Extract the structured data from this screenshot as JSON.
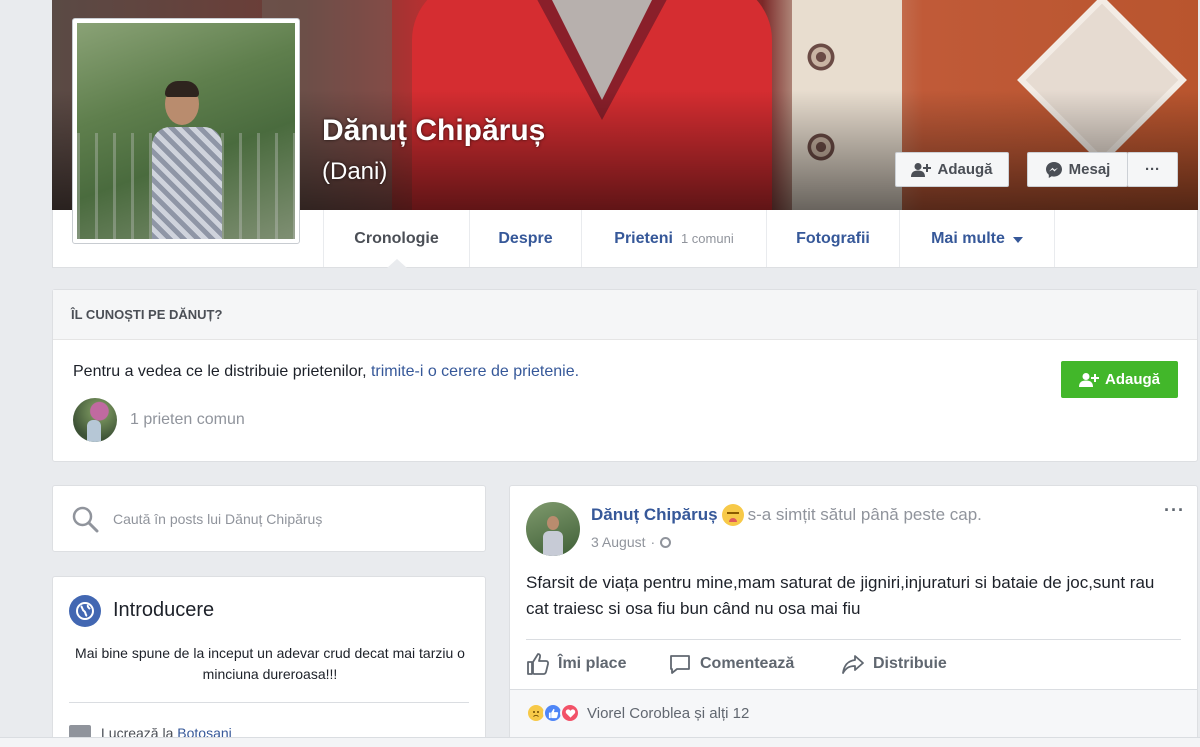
{
  "profile": {
    "name": "Dănuț Chipăruș",
    "nickname": "(Dani)"
  },
  "cover_buttons": {
    "add_label": "Adaugă",
    "message_label": "Mesaj",
    "more_label": "···"
  },
  "nav": {
    "tabs": [
      {
        "label": "Cronologie"
      },
      {
        "label": "Despre"
      },
      {
        "label": "Prieteni",
        "sub": "1 comuni"
      },
      {
        "label": "Fotografii"
      },
      {
        "label": "Mai multe"
      }
    ]
  },
  "know_card": {
    "heading": "ÎL CUNOȘTI PE DĂNUȚ?",
    "text": "Pentru a vedea ce le distribuie prietenilor, ",
    "link": "trimite-i o cerere de prietenie.",
    "add_label": "Adaugă",
    "mutual": "1 prieten comun"
  },
  "search": {
    "placeholder": "Caută în posts lui Dănuț Chipăruș"
  },
  "intro": {
    "title": "Introducere",
    "bio": "Mai bine spune de la inceput un adevar crud decat mai tarziu o minciuna dureroasa!!!",
    "work_prefix": "Lucrează la ",
    "work_place": "Botosani"
  },
  "post": {
    "author": "Dănuț Chipăruș",
    "feeling": "s-a simțit sătul până peste cap.",
    "date": "3 August",
    "dots": "···",
    "body": "Sfarsit de viața pentru mine,mam saturat de jigniri,injuraturi si bataie de joc,sunt rau cat traiesc si osa fiu bun când nu osa mai fiu",
    "actions": {
      "like": "Îmi place",
      "comment": "Comentează",
      "share": "Distribuie"
    },
    "reactions_text": "Viorel Coroblea și alți 12"
  },
  "colors": {
    "link_blue": "#365899",
    "green_button": "#42b72a",
    "background": "#e9ebee"
  },
  "icons": [
    "add-friend-icon",
    "messenger-icon",
    "search-icon",
    "globe-icon",
    "briefcase-icon",
    "like-icon",
    "comment-icon",
    "share-icon",
    "sad-reaction-icon",
    "like-reaction-icon",
    "love-reaction-icon"
  ]
}
